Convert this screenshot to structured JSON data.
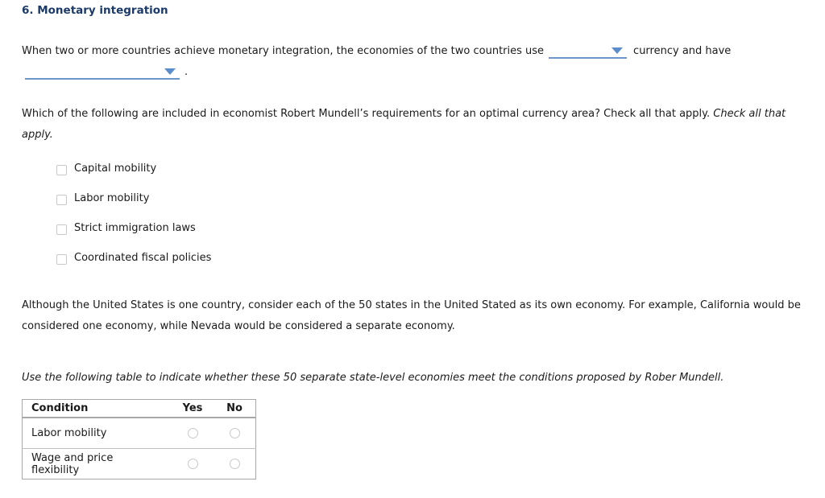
{
  "title": "6. Monetary integration",
  "section1": {
    "text_before": "When two or more countries achieve monetary integration, the economies of the two countries use",
    "dropdown1_value": "",
    "text_middle": "currency and have",
    "dropdown2_value": "",
    "text_after": "."
  },
  "section2": {
    "question": "Which of the following are included in economist Robert Mundell’s requirements for an optimal currency area? Check all that apply.",
    "instruction": "Check all that apply.",
    "options": [
      {
        "label": "Capital mobility",
        "checked": false
      },
      {
        "label": "Labor mobility",
        "checked": false
      },
      {
        "label": "Strict immigration laws",
        "checked": false
      },
      {
        "label": "Coordinated fiscal policies",
        "checked": false
      }
    ]
  },
  "section3": {
    "text": "Although the United States is one country, consider each of the 50 states in the United Stated as its own economy. For example, California would be considered one economy, while Nevada would be considered a separate economy."
  },
  "section4": {
    "instruction": "Use the following table to indicate whether these 50 separate state-level economies meet the conditions proposed by Rober Mundell.",
    "table": {
      "headers": [
        "Condition",
        "Yes",
        "No"
      ],
      "rows": [
        {
          "condition": "Labor mobility",
          "selected": null
        },
        {
          "condition": "Wage and price flexibility",
          "selected": null
        }
      ]
    }
  },
  "colors": {
    "title": "#1b3a6a",
    "dropdown_accent": "#6a96cc"
  }
}
